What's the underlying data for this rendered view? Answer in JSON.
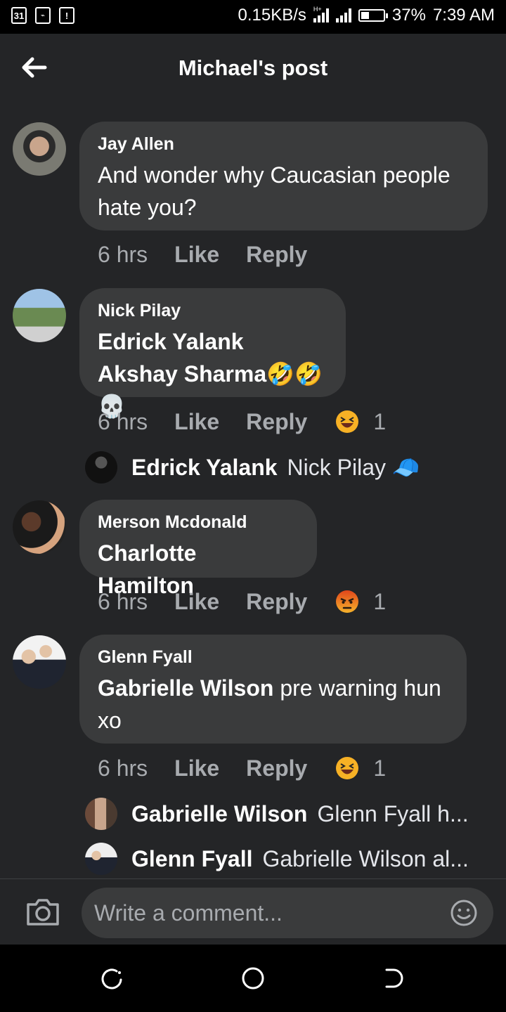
{
  "status_bar": {
    "calendar_day": "31",
    "net_speed": "0.15KB/s",
    "network_type": "H+",
    "battery": "37%",
    "battery_level": 0.37,
    "time": "7:39 AM"
  },
  "header": {
    "title": "Michael's post"
  },
  "comments": [
    {
      "author": "Jay Allen",
      "text": "And wonder why Caucasian people hate you?",
      "time": "6 hrs",
      "like": "Like",
      "reply": "Reply"
    },
    {
      "author": "Nick Pilay",
      "mentions": "Edrick Yalank Akshay Sharma",
      "emojis": "🤣🤣💀",
      "time": "6 hrs",
      "like": "Like",
      "reply": "Reply",
      "reaction_icon": "laughing-face-icon",
      "reaction_count": "1",
      "replies": [
        {
          "name": "Edrick Yalank",
          "text": "Nick Pilay 🧢"
        }
      ]
    },
    {
      "author": "Merson Mcdonald",
      "mentions": "Charlotte Hamilton",
      "time": "6 hrs",
      "like": "Like",
      "reply": "Reply",
      "reaction_icon": "angry-face-icon",
      "reaction_count": "1"
    },
    {
      "author": "Glenn Fyall",
      "mentions": "Gabrielle Wilson",
      "text": " pre warning hun xo",
      "time": "6 hrs",
      "like": "Like",
      "reply": "Reply",
      "reaction_icon": "laughing-face-icon",
      "reaction_count": "1",
      "replies": [
        {
          "name": "Gabrielle Wilson",
          "text": "Glenn Fyall h..."
        },
        {
          "name": "Glenn Fyall",
          "text": "Gabrielle Wilson al..."
        }
      ]
    }
  ],
  "composer": {
    "placeholder": "Write a comment..."
  },
  "colors": {
    "background": "#242527",
    "bubble": "#3a3b3c",
    "muted_text": "#a8abaf",
    "reaction_yellow": "#f7b125",
    "reaction_angry": "#e9710f"
  }
}
